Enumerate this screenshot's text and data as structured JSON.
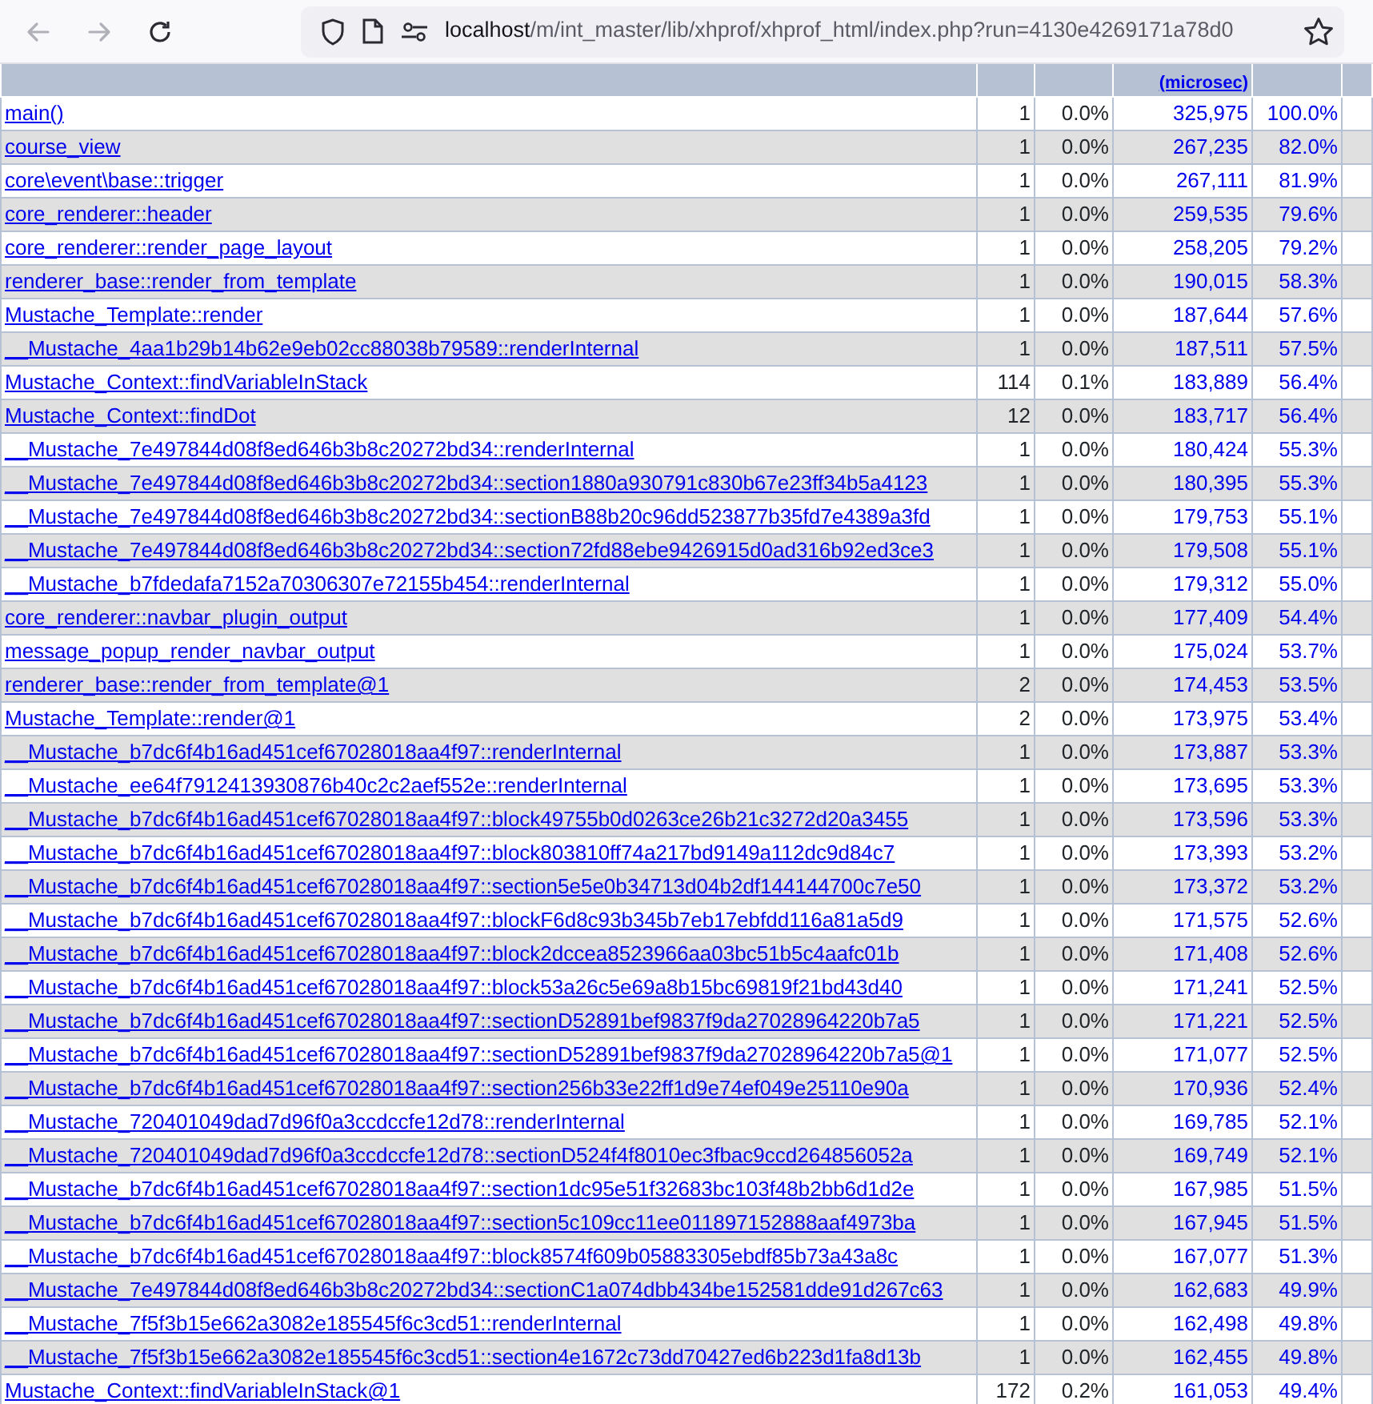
{
  "browser": {
    "url_host": "localhost",
    "url_path": "/m/int_master/lib/xhprof/xhprof_html/index.php?run=4130e4269171a78d0",
    "back_disabled": true,
    "forward_disabled": true
  },
  "table": {
    "header": {
      "column_4": "(microsec)"
    },
    "rows": [
      {
        "function": "main()",
        "calls": "1",
        "calls_pct": "0.0%",
        "incl_wall": "325,975",
        "incl_wall_pct": "100.0%"
      },
      {
        "function": "course_view",
        "calls": "1",
        "calls_pct": "0.0%",
        "incl_wall": "267,235",
        "incl_wall_pct": "82.0%"
      },
      {
        "function": "core\\event\\base::trigger",
        "calls": "1",
        "calls_pct": "0.0%",
        "incl_wall": "267,111",
        "incl_wall_pct": "81.9%"
      },
      {
        "function": "core_renderer::header",
        "calls": "1",
        "calls_pct": "0.0%",
        "incl_wall": "259,535",
        "incl_wall_pct": "79.6%"
      },
      {
        "function": "core_renderer::render_page_layout",
        "calls": "1",
        "calls_pct": "0.0%",
        "incl_wall": "258,205",
        "incl_wall_pct": "79.2%"
      },
      {
        "function": "renderer_base::render_from_template",
        "calls": "1",
        "calls_pct": "0.0%",
        "incl_wall": "190,015",
        "incl_wall_pct": "58.3%"
      },
      {
        "function": "Mustache_Template::render",
        "calls": "1",
        "calls_pct": "0.0%",
        "incl_wall": "187,644",
        "incl_wall_pct": "57.6%"
      },
      {
        "function": "__Mustache_4aa1b29b14b62e9eb02cc88038b79589::renderInternal",
        "calls": "1",
        "calls_pct": "0.0%",
        "incl_wall": "187,511",
        "incl_wall_pct": "57.5%"
      },
      {
        "function": "Mustache_Context::findVariableInStack",
        "calls": "114",
        "calls_pct": "0.1%",
        "incl_wall": "183,889",
        "incl_wall_pct": "56.4%"
      },
      {
        "function": "Mustache_Context::findDot",
        "calls": "12",
        "calls_pct": "0.0%",
        "incl_wall": "183,717",
        "incl_wall_pct": "56.4%"
      },
      {
        "function": "__Mustache_7e497844d08f8ed646b3b8c20272bd34::renderInternal",
        "calls": "1",
        "calls_pct": "0.0%",
        "incl_wall": "180,424",
        "incl_wall_pct": "55.3%"
      },
      {
        "function": "__Mustache_7e497844d08f8ed646b3b8c20272bd34::section1880a930791c830b67e23ff34b5a4123",
        "calls": "1",
        "calls_pct": "0.0%",
        "incl_wall": "180,395",
        "incl_wall_pct": "55.3%"
      },
      {
        "function": "__Mustache_7e497844d08f8ed646b3b8c20272bd34::sectionB88b20c96dd523877b35fd7e4389a3fd",
        "calls": "1",
        "calls_pct": "0.0%",
        "incl_wall": "179,753",
        "incl_wall_pct": "55.1%"
      },
      {
        "function": "__Mustache_7e497844d08f8ed646b3b8c20272bd34::section72fd88ebe9426915d0ad316b92ed3ce3",
        "calls": "1",
        "calls_pct": "0.0%",
        "incl_wall": "179,508",
        "incl_wall_pct": "55.1%"
      },
      {
        "function": "__Mustache_b7fdedafa7152a70306307e72155b454::renderInternal",
        "calls": "1",
        "calls_pct": "0.0%",
        "incl_wall": "179,312",
        "incl_wall_pct": "55.0%"
      },
      {
        "function": "core_renderer::navbar_plugin_output",
        "calls": "1",
        "calls_pct": "0.0%",
        "incl_wall": "177,409",
        "incl_wall_pct": "54.4%"
      },
      {
        "function": "message_popup_render_navbar_output",
        "calls": "1",
        "calls_pct": "0.0%",
        "incl_wall": "175,024",
        "incl_wall_pct": "53.7%"
      },
      {
        "function": "renderer_base::render_from_template@1",
        "calls": "2",
        "calls_pct": "0.0%",
        "incl_wall": "174,453",
        "incl_wall_pct": "53.5%"
      },
      {
        "function": "Mustache_Template::render@1",
        "calls": "2",
        "calls_pct": "0.0%",
        "incl_wall": "173,975",
        "incl_wall_pct": "53.4%"
      },
      {
        "function": "__Mustache_b7dc6f4b16ad451cef67028018aa4f97::renderInternal",
        "calls": "1",
        "calls_pct": "0.0%",
        "incl_wall": "173,887",
        "incl_wall_pct": "53.3%"
      },
      {
        "function": "__Mustache_ee64f7912413930876b40c2c2aef552e::renderInternal",
        "calls": "1",
        "calls_pct": "0.0%",
        "incl_wall": "173,695",
        "incl_wall_pct": "53.3%"
      },
      {
        "function": "__Mustache_b7dc6f4b16ad451cef67028018aa4f97::block49755b0d0263ce26b21c3272d20a3455",
        "calls": "1",
        "calls_pct": "0.0%",
        "incl_wall": "173,596",
        "incl_wall_pct": "53.3%"
      },
      {
        "function": "__Mustache_b7dc6f4b16ad451cef67028018aa4f97::block803810ff74a217bd9149a112dc9d84c7",
        "calls": "1",
        "calls_pct": "0.0%",
        "incl_wall": "173,393",
        "incl_wall_pct": "53.2%"
      },
      {
        "function": "__Mustache_b7dc6f4b16ad451cef67028018aa4f97::section5e5e0b34713d04b2df144144700c7e50",
        "calls": "1",
        "calls_pct": "0.0%",
        "incl_wall": "173,372",
        "incl_wall_pct": "53.2%"
      },
      {
        "function": "__Mustache_b7dc6f4b16ad451cef67028018aa4f97::blockF6d8c93b345b7eb17ebfdd116a81a5d9",
        "calls": "1",
        "calls_pct": "0.0%",
        "incl_wall": "171,575",
        "incl_wall_pct": "52.6%"
      },
      {
        "function": "__Mustache_b7dc6f4b16ad451cef67028018aa4f97::block2dccea8523966aa03bc51b5c4aafc01b",
        "calls": "1",
        "calls_pct": "0.0%",
        "incl_wall": "171,408",
        "incl_wall_pct": "52.6%"
      },
      {
        "function": "__Mustache_b7dc6f4b16ad451cef67028018aa4f97::block53a26c5e69a8b15bc69819f21bd43d40",
        "calls": "1",
        "calls_pct": "0.0%",
        "incl_wall": "171,241",
        "incl_wall_pct": "52.5%"
      },
      {
        "function": "__Mustache_b7dc6f4b16ad451cef67028018aa4f97::sectionD52891bef9837f9da27028964220b7a5",
        "calls": "1",
        "calls_pct": "0.0%",
        "incl_wall": "171,221",
        "incl_wall_pct": "52.5%"
      },
      {
        "function": "__Mustache_b7dc6f4b16ad451cef67028018aa4f97::sectionD52891bef9837f9da27028964220b7a5@1",
        "calls": "1",
        "calls_pct": "0.0%",
        "incl_wall": "171,077",
        "incl_wall_pct": "52.5%"
      },
      {
        "function": "__Mustache_b7dc6f4b16ad451cef67028018aa4f97::section256b33e22ff1d9e74ef049e25110e90a",
        "calls": "1",
        "calls_pct": "0.0%",
        "incl_wall": "170,936",
        "incl_wall_pct": "52.4%"
      },
      {
        "function": "__Mustache_720401049dad7d96f0a3ccdccfe12d78::renderInternal",
        "calls": "1",
        "calls_pct": "0.0%",
        "incl_wall": "169,785",
        "incl_wall_pct": "52.1%"
      },
      {
        "function": "__Mustache_720401049dad7d96f0a3ccdccfe12d78::sectionD524f4f8010ec3fbac9ccd264856052a",
        "calls": "1",
        "calls_pct": "0.0%",
        "incl_wall": "169,749",
        "incl_wall_pct": "52.1%"
      },
      {
        "function": "__Mustache_b7dc6f4b16ad451cef67028018aa4f97::section1dc95e51f32683bc103f48b2bb6d1d2e",
        "calls": "1",
        "calls_pct": "0.0%",
        "incl_wall": "167,985",
        "incl_wall_pct": "51.5%"
      },
      {
        "function": "__Mustache_b7dc6f4b16ad451cef67028018aa4f97::section5c109cc11ee011897152888aaf4973ba",
        "calls": "1",
        "calls_pct": "0.0%",
        "incl_wall": "167,945",
        "incl_wall_pct": "51.5%"
      },
      {
        "function": "__Mustache_b7dc6f4b16ad451cef67028018aa4f97::block8574f609b05883305ebdf85b73a43a8c",
        "calls": "1",
        "calls_pct": "0.0%",
        "incl_wall": "167,077",
        "incl_wall_pct": "51.3%"
      },
      {
        "function": "__Mustache_7e497844d08f8ed646b3b8c20272bd34::sectionC1a074dbb434be152581dde91d267c63",
        "calls": "1",
        "calls_pct": "0.0%",
        "incl_wall": "162,683",
        "incl_wall_pct": "49.9%"
      },
      {
        "function": "__Mustache_7f5f3b15e662a3082e185545f6c3cd51::renderInternal",
        "calls": "1",
        "calls_pct": "0.0%",
        "incl_wall": "162,498",
        "incl_wall_pct": "49.8%"
      },
      {
        "function": "__Mustache_7f5f3b15e662a3082e185545f6c3cd51::section4e1672c73dd70427ed6b223d1fa8d13b",
        "calls": "1",
        "calls_pct": "0.0%",
        "incl_wall": "162,455",
        "incl_wall_pct": "49.8%"
      },
      {
        "function": "Mustache_Context::findVariableInStack@1",
        "calls": "172",
        "calls_pct": "0.2%",
        "incl_wall": "161,053",
        "incl_wall_pct": "49.4%"
      }
    ]
  }
}
